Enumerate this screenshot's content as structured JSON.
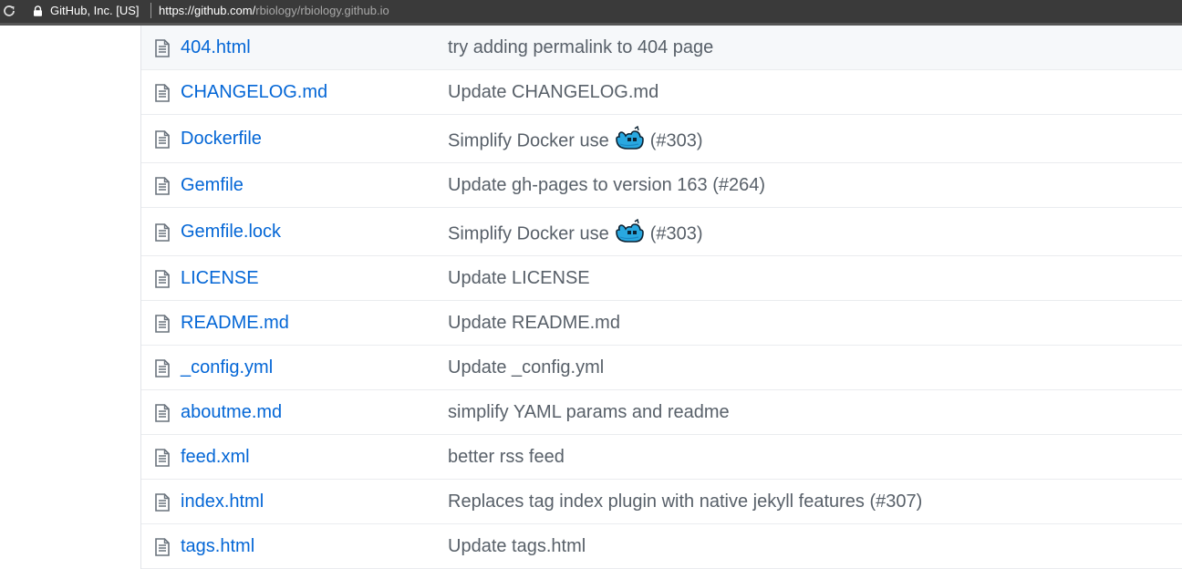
{
  "browser": {
    "site_identity": "GitHub, Inc. [US]",
    "url_host": "https://github.com/",
    "url_path": "rbiology/rbiology.github.io",
    "reload_icon": "reload-icon",
    "lock_icon": "lock-icon"
  },
  "files": [
    {
      "name": "404.html",
      "message": "try adding permalink to 404 page",
      "emoji": false
    },
    {
      "name": "CHANGELOG.md",
      "message": "Update CHANGELOG.md",
      "emoji": false
    },
    {
      "name": "Dockerfile",
      "message": "Simplify Docker use",
      "emoji": true,
      "suffix": "(#303)"
    },
    {
      "name": "Gemfile",
      "message": "Update gh-pages to version 163 (#264)",
      "emoji": false
    },
    {
      "name": "Gemfile.lock",
      "message": "Simplify Docker use",
      "emoji": true,
      "suffix": "(#303)"
    },
    {
      "name": "LICENSE",
      "message": "Update LICENSE",
      "emoji": false
    },
    {
      "name": "README.md",
      "message": "Update README.md",
      "emoji": false
    },
    {
      "name": "_config.yml",
      "message": "Update _config.yml",
      "emoji": false
    },
    {
      "name": "aboutme.md",
      "message": "simplify YAML params and readme",
      "emoji": false
    },
    {
      "name": "feed.xml",
      "message": "better rss feed",
      "emoji": false
    },
    {
      "name": "index.html",
      "message": "Replaces tag index plugin with native jekyll features (#307)",
      "emoji": false
    },
    {
      "name": "tags.html",
      "message": "Update tags.html",
      "emoji": false
    }
  ],
  "colors": {
    "link": "#0366d6",
    "message": "#586069",
    "row_border": "#eaecef",
    "row_shaded": "#f6f8fa",
    "browser_bar": "#3a3a3a"
  },
  "icons": {
    "file": "file-text-icon",
    "emoji": "whale-emoji-icon"
  }
}
